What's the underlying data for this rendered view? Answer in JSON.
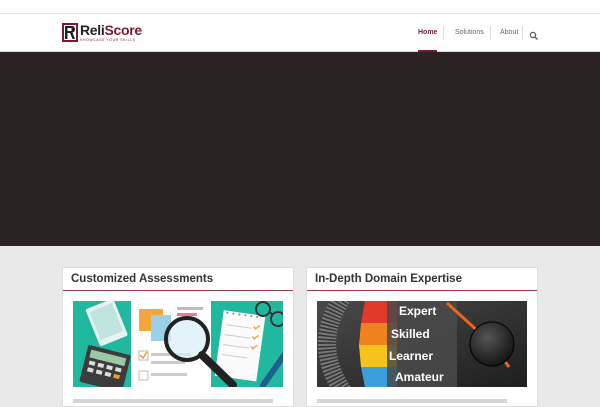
{
  "brand": {
    "name_part1": "Reli",
    "name_part2": "Score",
    "tagline": "SHOWCASE YOUR SKILLS"
  },
  "nav": {
    "items": [
      {
        "label": "Home"
      },
      {
        "label": "Solutions"
      },
      {
        "label": "About"
      }
    ],
    "search_icon": "search-icon"
  },
  "cards": [
    {
      "title": "Customized Assessments"
    },
    {
      "title": "In-Depth Domain Expertise",
      "gauge_labels": [
        "Expert",
        "Skilled",
        "Learner",
        "Amateur"
      ]
    }
  ],
  "colors": {
    "brand": "#7b1a2e",
    "hero": "#2a2223",
    "teal": "#21b8a0"
  }
}
